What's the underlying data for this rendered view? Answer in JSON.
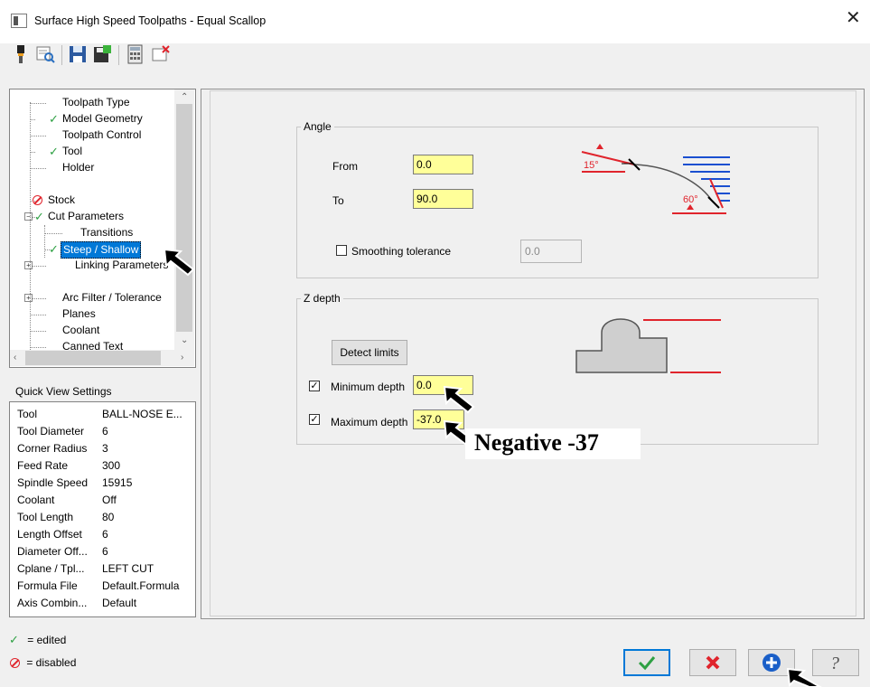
{
  "window": {
    "title": "Surface High Speed Toolpaths - Equal Scallop"
  },
  "tree": {
    "items": [
      {
        "label": "Toolpath Type",
        "state": "none"
      },
      {
        "label": "Model Geometry",
        "state": "edited"
      },
      {
        "label": "Toolpath Control",
        "state": "none"
      },
      {
        "label": "Tool",
        "state": "edited"
      },
      {
        "label": "Holder",
        "state": "none"
      },
      {
        "label": "Stock",
        "state": "disabled"
      },
      {
        "label": "Cut Parameters",
        "state": "edited"
      },
      {
        "label": "Transitions",
        "state": "none"
      },
      {
        "label": "Steep / Shallow",
        "state": "edited"
      },
      {
        "label": "Linking Parameters",
        "state": "none"
      },
      {
        "label": "Arc Filter / Tolerance",
        "state": "none"
      },
      {
        "label": "Planes",
        "state": "none"
      },
      {
        "label": "Coolant",
        "state": "none"
      },
      {
        "label": "Canned Text",
        "state": "none"
      }
    ]
  },
  "quick_view": {
    "title": "Quick View Settings",
    "rows": [
      {
        "key": "Tool",
        "value": "BALL-NOSE E..."
      },
      {
        "key": "Tool Diameter",
        "value": "6"
      },
      {
        "key": "Corner Radius",
        "value": "3"
      },
      {
        "key": "Feed Rate",
        "value": "300"
      },
      {
        "key": "Spindle Speed",
        "value": "15915"
      },
      {
        "key": "Coolant",
        "value": "Off"
      },
      {
        "key": "Tool Length",
        "value": "80"
      },
      {
        "key": "Length Offset",
        "value": "6"
      },
      {
        "key": "Diameter Off...",
        "value": "6"
      },
      {
        "key": "Cplane / Tpl...",
        "value": "LEFT CUT"
      },
      {
        "key": "Formula File",
        "value": "Default.Formula"
      },
      {
        "key": "Axis Combin...",
        "value": "Default"
      }
    ]
  },
  "legend": {
    "edited": "= edited",
    "disabled": "= disabled"
  },
  "angle": {
    "title": "Angle",
    "from_label": "From",
    "from_value": "0.0",
    "to_label": "To",
    "to_value": "90.0",
    "smoothing_label": "Smoothing tolerance",
    "smoothing_value": "0.0",
    "diagram_15": "15°",
    "diagram_60": "60°"
  },
  "zdepth": {
    "title": "Z depth",
    "detect_label": "Detect limits",
    "min_label": "Minimum depth",
    "min_value": "0.0",
    "max_label": "Maximum depth",
    "max_value": "-37.0"
  },
  "annotation": {
    "text": "Negative -37"
  },
  "colors": {
    "accent": "#0078d7",
    "yellow": "#ffff99",
    "red": "#e0242c",
    "green": "#2ea043"
  }
}
